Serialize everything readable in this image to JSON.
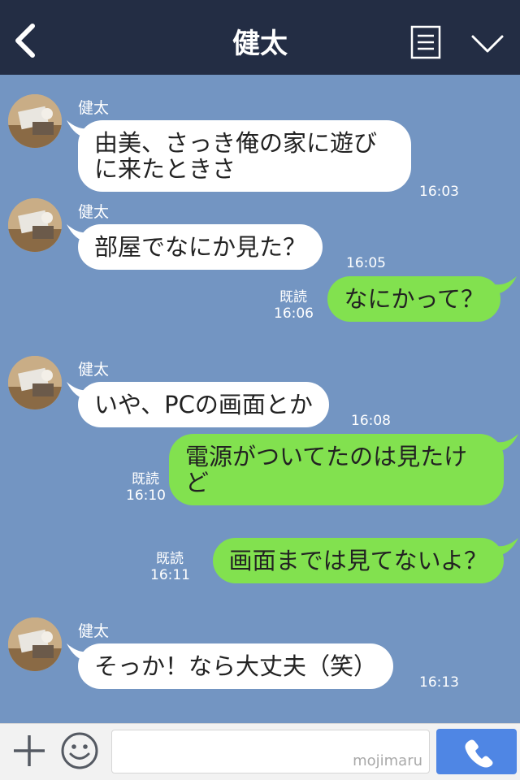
{
  "header": {
    "title": "健太",
    "back_icon": "chevron-left-icon",
    "menu_icon": "list-icon",
    "expand_icon": "chevron-down-icon",
    "background": "#232d44"
  },
  "chat": {
    "background": "#7395c2",
    "incoming_bubble_color": "#ffffff",
    "outgoing_bubble_color": "#82e14f",
    "messages": [
      {
        "direction": "in",
        "sender": "健太",
        "text": "由美、さっき俺の家に遊び\nに来たときさ",
        "time": "16:03"
      },
      {
        "direction": "in",
        "sender": "健太",
        "text": "部屋でなにか見た？",
        "time": "16:05"
      },
      {
        "direction": "out",
        "read": "既読",
        "text": "なにかって？",
        "time": "16:06"
      },
      {
        "direction": "in",
        "sender": "健太",
        "text": "いや、PCの画面とか",
        "time": "16:08"
      },
      {
        "direction": "out",
        "read": "既読",
        "text": "電源がついてたのは見たけ\nど",
        "time": "16:10"
      },
      {
        "direction": "out",
        "read": "既読",
        "text": "画面までは見てないよ？",
        "time": "16:11"
      },
      {
        "direction": "in",
        "sender": "健太",
        "text": "そっか！なら大丈夫（笑）",
        "time": "16:13"
      }
    ]
  },
  "footer": {
    "plus_icon": "plus-icon",
    "emoji_icon": "smiley-icon",
    "input_value": "",
    "watermark": "mojimaru",
    "call_icon": "phone-icon",
    "call_button_color": "#4f86e4"
  }
}
